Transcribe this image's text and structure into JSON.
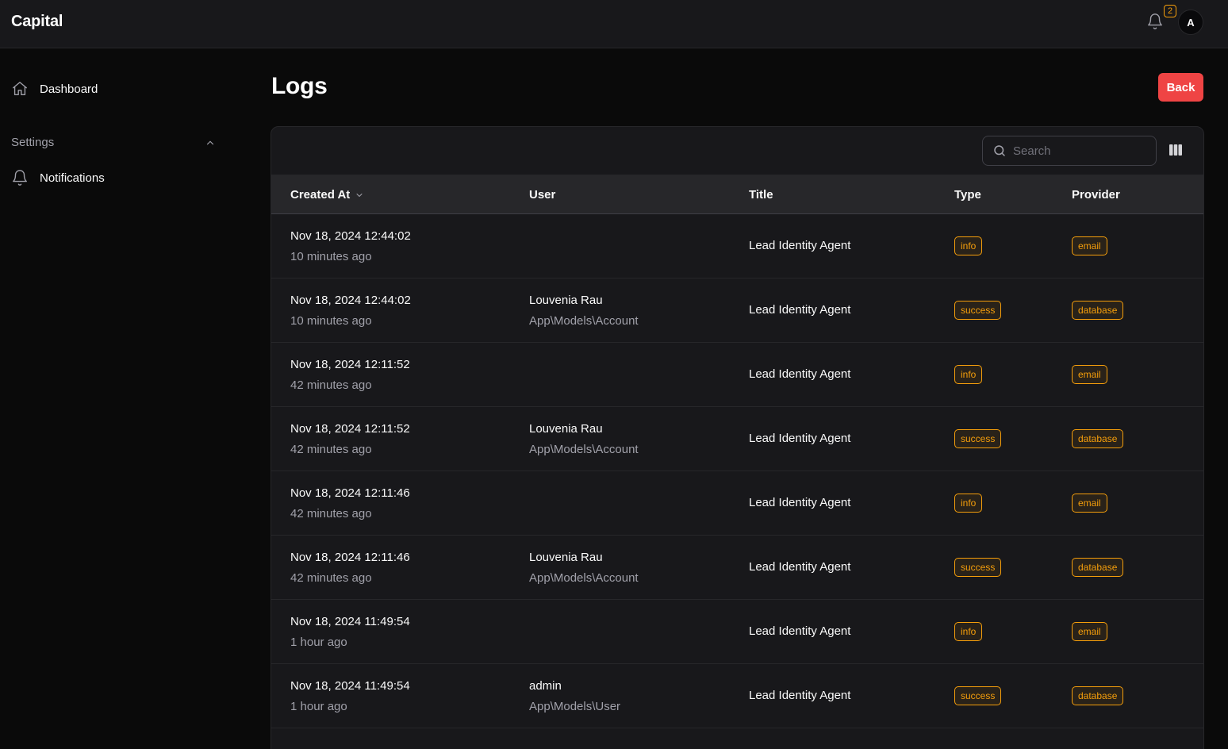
{
  "app": {
    "brand": "Capital",
    "notifications_count": "2",
    "avatar_initial": "A"
  },
  "sidebar": {
    "dashboard_label": "Dashboard",
    "settings_label": "Settings",
    "notifications_label": "Notifications"
  },
  "page": {
    "title": "Logs",
    "back_label": "Back"
  },
  "table": {
    "search_placeholder": "Search",
    "columns": {
      "created_at": "Created At",
      "user": "User",
      "title": "Title",
      "type": "Type",
      "provider": "Provider"
    },
    "rows": [
      {
        "date": "Nov 18, 2024 12:44:02",
        "ago": "10 minutes ago",
        "user_name": "",
        "user_model": "",
        "title": "Lead Identity Agent",
        "type": "info",
        "provider": "email"
      },
      {
        "date": "Nov 18, 2024 12:44:02",
        "ago": "10 minutes ago",
        "user_name": "Louvenia Rau",
        "user_model": "App\\Models\\Account",
        "title": "Lead Identity Agent",
        "type": "success",
        "provider": "database"
      },
      {
        "date": "Nov 18, 2024 12:11:52",
        "ago": "42 minutes ago",
        "user_name": "",
        "user_model": "",
        "title": "Lead Identity Agent",
        "type": "info",
        "provider": "email"
      },
      {
        "date": "Nov 18, 2024 12:11:52",
        "ago": "42 minutes ago",
        "user_name": "Louvenia Rau",
        "user_model": "App\\Models\\Account",
        "title": "Lead Identity Agent",
        "type": "success",
        "provider": "database"
      },
      {
        "date": "Nov 18, 2024 12:11:46",
        "ago": "42 minutes ago",
        "user_name": "",
        "user_model": "",
        "title": "Lead Identity Agent",
        "type": "info",
        "provider": "email"
      },
      {
        "date": "Nov 18, 2024 12:11:46",
        "ago": "42 minutes ago",
        "user_name": "Louvenia Rau",
        "user_model": "App\\Models\\Account",
        "title": "Lead Identity Agent",
        "type": "success",
        "provider": "database"
      },
      {
        "date": "Nov 18, 2024 11:49:54",
        "ago": "1 hour ago",
        "user_name": "",
        "user_model": "",
        "title": "Lead Identity Agent",
        "type": "info",
        "provider": "email"
      },
      {
        "date": "Nov 18, 2024 11:49:54",
        "ago": "1 hour ago",
        "user_name": "admin",
        "user_model": "App\\Models\\User",
        "title": "Lead Identity Agent",
        "type": "success",
        "provider": "database"
      }
    ]
  },
  "colors": {
    "accent_badge": "#f59e0b",
    "danger_button": "#ef4444"
  },
  "icons": {
    "dashboard": "home-icon",
    "notifications": "bell-icon",
    "settings_toggle": "chevron-up-icon",
    "search": "search-icon",
    "columns": "columns-icon",
    "sort": "chevron-down-icon"
  }
}
